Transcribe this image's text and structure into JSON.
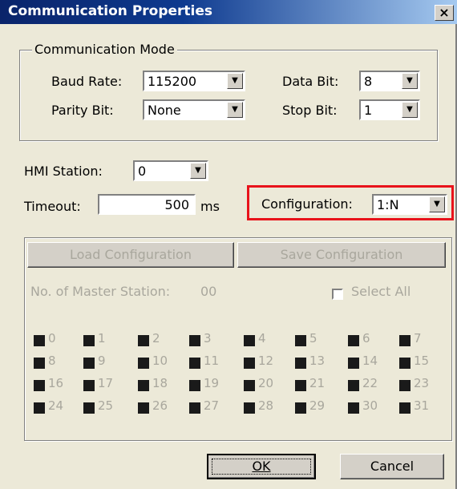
{
  "window": {
    "title": "Communication Properties",
    "close_label": "×"
  },
  "comm_mode": {
    "legend": "Communication Mode",
    "baud_rate_label": "Baud Rate:",
    "baud_rate_value": "115200",
    "data_bit_label": "Data Bit:",
    "data_bit_value": "8",
    "parity_bit_label": "Parity Bit:",
    "parity_bit_value": "None",
    "stop_bit_label": "Stop Bit:",
    "stop_bit_value": "1"
  },
  "hmi_station": {
    "label": "HMI Station:",
    "value": "0"
  },
  "timeout": {
    "label": "Timeout:",
    "value": "500",
    "unit": "ms"
  },
  "configuration": {
    "label": "Configuration:",
    "value": "1:N",
    "highlight_color": "#e8131b"
  },
  "master": {
    "load_label": "Load Configuration",
    "save_label": "Save Configuration",
    "count_label": "No. of Master Station:",
    "count_value": "00",
    "select_all_label": "Select All",
    "stations": [
      "0",
      "1",
      "2",
      "3",
      "4",
      "5",
      "6",
      "7",
      "8",
      "9",
      "10",
      "11",
      "12",
      "13",
      "14",
      "15",
      "16",
      "17",
      "18",
      "19",
      "20",
      "21",
      "22",
      "23",
      "24",
      "25",
      "26",
      "27",
      "28",
      "29",
      "30",
      "31"
    ]
  },
  "buttons": {
    "ok_label": "OK",
    "cancel_label": "Cancel"
  }
}
